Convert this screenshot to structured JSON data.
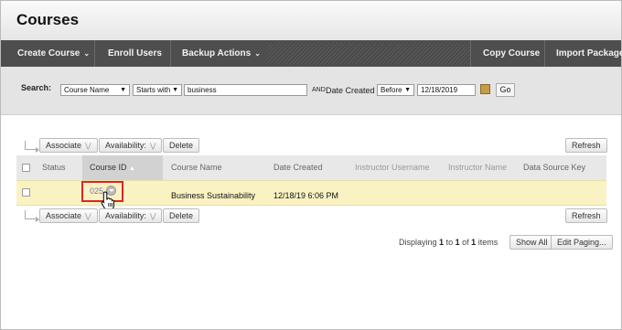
{
  "page": {
    "title": "Courses"
  },
  "nav": {
    "create_course": "Create Course",
    "enroll_users": "Enroll Users",
    "backup_actions": "Backup Actions",
    "copy_course": "Copy Course",
    "import_package": "Import Package"
  },
  "search": {
    "label": "Search:",
    "field_select": "Course Name",
    "operator_select": "Starts with",
    "query_value": "business",
    "and_label": "AND",
    "date_label": "Date Created",
    "date_operator": "Before",
    "date_value": "12/18/2019",
    "go_label": "Go"
  },
  "toolbar": {
    "associate": "Associate",
    "availability": "Availability:",
    "delete": "Delete",
    "refresh": "Refresh"
  },
  "table": {
    "columns": {
      "status": "Status",
      "course_id": "Course ID",
      "course_name": "Course Name",
      "date_created": "Date Created",
      "instructor_username": "Instructor Username",
      "instructor_name": "Instructor Name",
      "data_source_key": "Data Source Key"
    },
    "rows": [
      {
        "course_id": "025",
        "course_name": "Business Sustainability",
        "date_created": "12/18/19 6:06 PM"
      }
    ]
  },
  "paging": {
    "prefix": "Displaying",
    "from": "1",
    "to_word": "to",
    "to": "1",
    "of_word": "of",
    "total": "1",
    "suffix": "items",
    "show_all": "Show All",
    "edit_paging": "Edit Paging..."
  }
}
